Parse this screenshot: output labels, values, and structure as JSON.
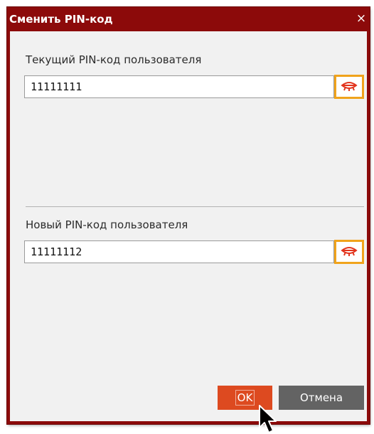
{
  "dialog": {
    "title": "Сменить PIN-код",
    "close_glyph": "×",
    "current_pin": {
      "label": "Текущий PIN-код пользователя",
      "value": "11111111",
      "toggle_icon": "eye-closed-icon"
    },
    "new_pin": {
      "label": "Новый PIN-код пользователя",
      "value": "11111112",
      "toggle_icon": "eye-closed-icon"
    },
    "buttons": {
      "ok_label": "OK",
      "cancel_label": "Отмена"
    }
  },
  "colors": {
    "title_bar": "#8c0a0a",
    "body": "#f1f1f1",
    "highlight": "#f0a31c",
    "eye_icon": "#e2341d",
    "ok_button": "#dd4a20",
    "cancel_button": "#636363"
  }
}
